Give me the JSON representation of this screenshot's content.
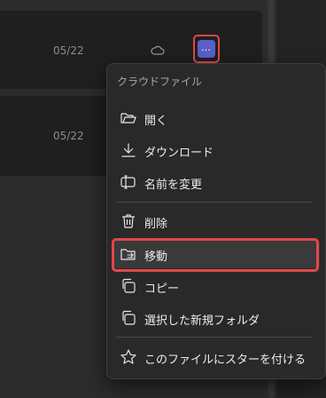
{
  "file_list": {
    "rows": [
      {
        "date": "05/22",
        "has_cloud_icon": true,
        "more_label": "…"
      },
      {
        "date": "05/22",
        "has_cloud_icon": false
      }
    ]
  },
  "context_menu": {
    "section_title": "クラウドファイル",
    "items": [
      {
        "label": "開く",
        "icon": "folder-open-icon"
      },
      {
        "label": "ダウンロード",
        "icon": "download-icon"
      },
      {
        "label": "名前を変更",
        "icon": "rename-icon"
      },
      {
        "label": "削除",
        "icon": "trash-icon"
      },
      {
        "label": "移動",
        "icon": "move-folder-icon",
        "highlighted": true
      },
      {
        "label": "コピー",
        "icon": "copy-icon"
      },
      {
        "label": "選択した新規フォルダ",
        "icon": "new-folder-icon"
      },
      {
        "label": "このファイルにスターを付ける",
        "icon": "star-icon"
      }
    ]
  },
  "colors": {
    "accent": "#5b5fc7",
    "highlight_outline": "#e0484a"
  }
}
